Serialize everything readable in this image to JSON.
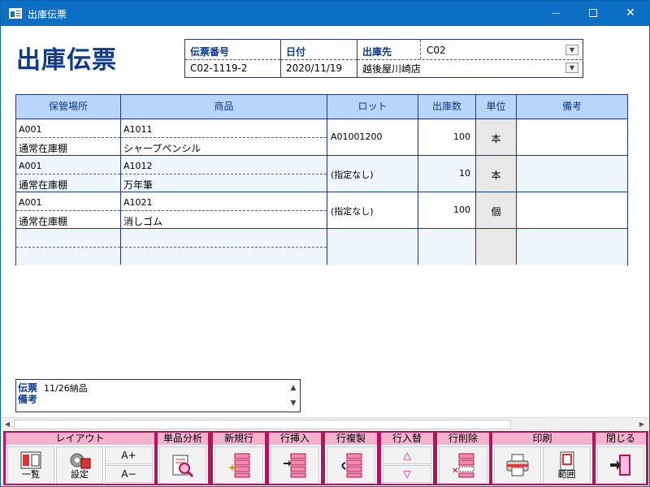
{
  "window": {
    "title": "出庫伝票"
  },
  "page_title": "出庫伝票",
  "header": {
    "slip_no_label": "伝票番号",
    "slip_no": "C02-1119-2",
    "date_label": "日付",
    "date": "2020/11/19",
    "dest_label": "出庫先",
    "dest_code": "C02",
    "dest_name": "越後屋川崎店"
  },
  "grid": {
    "columns": [
      "保管場所",
      "商品",
      "ロット",
      "出庫数",
      "単位",
      "備考"
    ],
    "rows": [
      {
        "loc_code": "A001",
        "loc_name": "通常在庫棚",
        "item_code": "A1011",
        "item_name": "シャープペンシル",
        "lot": "A01001200",
        "qty": "100",
        "unit": "本",
        "note": ""
      },
      {
        "loc_code": "A001",
        "loc_name": "通常在庫棚",
        "item_code": "A1012",
        "item_name": "万年筆",
        "lot": "(指定なし)",
        "qty": "10",
        "unit": "本",
        "note": ""
      },
      {
        "loc_code": "A001",
        "loc_name": "通常在庫棚",
        "item_code": "A1021",
        "item_name": "消しゴム",
        "lot": "(指定なし)",
        "qty": "100",
        "unit": "個",
        "note": ""
      }
    ]
  },
  "memo": {
    "label": "伝票備考",
    "label_line1": "伝票",
    "label_line2": "備考",
    "value": "11/26納品"
  },
  "toolbar": {
    "layout": {
      "label": "レイアウト",
      "list": "一覧",
      "settings": "設定",
      "font_up": "A+",
      "font_down": "A−"
    },
    "analysis": {
      "label": "単品分析"
    },
    "new_row": {
      "label": "新規行"
    },
    "insert_row": {
      "label": "行挿入"
    },
    "copy_row": {
      "label": "行複製"
    },
    "swap_row": {
      "label": "行入替"
    },
    "delete_row": {
      "label": "行削除"
    },
    "print": {
      "label": "印刷",
      "range": "範囲"
    },
    "close": {
      "label": "閉じる"
    }
  },
  "colors": {
    "title_bar": "#0b6fc4",
    "grid_header": "#b9d5f7",
    "label_text": "#0d3a8c",
    "toolbar": "#b5145a",
    "toolbar_group_label": "#f5b2cf"
  }
}
